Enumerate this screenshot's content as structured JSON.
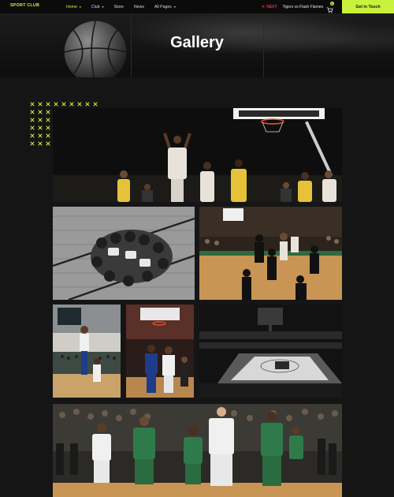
{
  "brand": {
    "logo_text": "SPORT CLUB",
    "accent": "#c8f23c",
    "alert": "#e0323c"
  },
  "nav": {
    "items": [
      {
        "label": "Home",
        "has_dropdown": true,
        "active": true
      },
      {
        "label": "Club",
        "has_dropdown": true,
        "active": false
      },
      {
        "label": "Store",
        "has_dropdown": false,
        "active": false
      },
      {
        "label": "News",
        "has_dropdown": false,
        "active": false
      },
      {
        "label": "All Pages",
        "has_dropdown": true,
        "active": false
      }
    ]
  },
  "next_match": {
    "label": "NEXT",
    "match": "Tigers vs Flash Flames"
  },
  "cart": {
    "count": "0",
    "icon": "cart-icon"
  },
  "cta": {
    "label": "Get in Touch"
  },
  "hero": {
    "title": "Gallery"
  },
  "gallery": {
    "photos": [
      {
        "subject": "free-throw-game-action",
        "tone": "color"
      },
      {
        "subject": "team-huddle-overhead",
        "tone": "grayscale"
      },
      {
        "subject": "rebound-under-basket",
        "tone": "color"
      },
      {
        "subject": "layup-near-basket",
        "tone": "color"
      },
      {
        "subject": "dribble-drive",
        "tone": "color"
      },
      {
        "subject": "empty-arena-court",
        "tone": "grayscale"
      },
      {
        "subject": "players-at-free-throw-line-crowd",
        "tone": "color"
      }
    ]
  }
}
